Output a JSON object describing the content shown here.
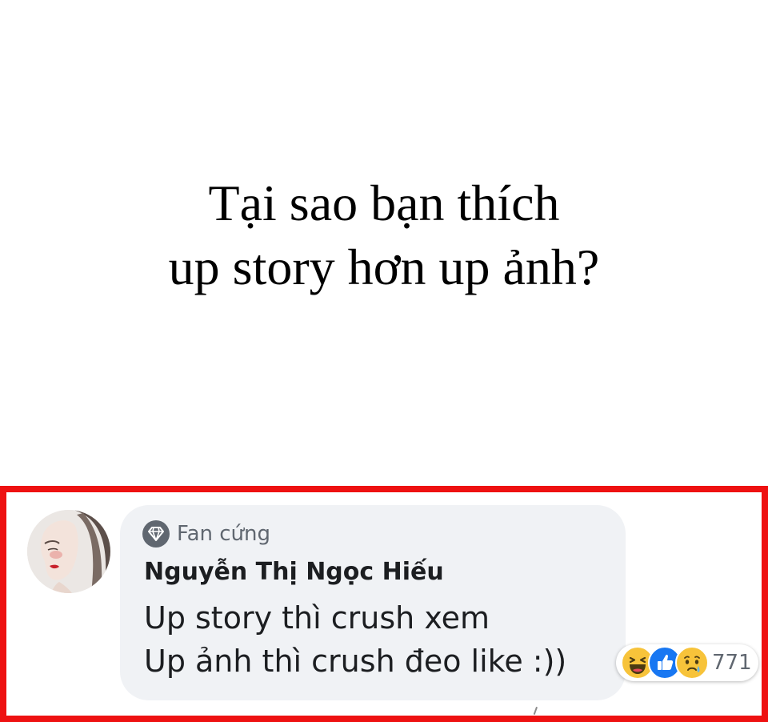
{
  "question": {
    "line1": "Tại sao bạn thích",
    "line2": "up story hơn up ảnh?"
  },
  "comment": {
    "badge_icon": "diamond-icon",
    "badge_label": "Fan cứng",
    "author": "Nguyễn Thị Ngọc Hiếu",
    "text_line1": "Up story thì crush xem",
    "text_line2": "Up ảnh thì crush đeo like :))",
    "reactions": {
      "icons": [
        "haha-icon",
        "like-icon",
        "sad-icon"
      ],
      "count": "771"
    }
  },
  "colors": {
    "highlight_border": "#ee1111",
    "bubble_bg": "#f0f2f5",
    "like_blue": "#1877f2",
    "emoji_yellow": "#f7c33a"
  }
}
